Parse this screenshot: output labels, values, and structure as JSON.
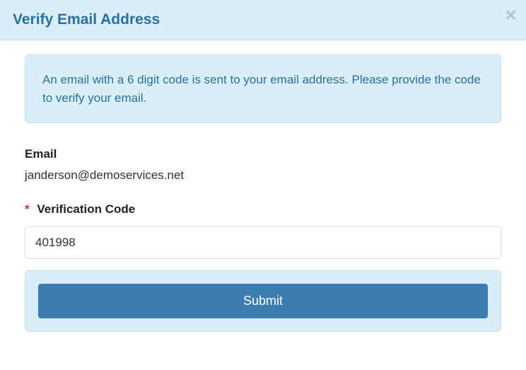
{
  "header": {
    "title": "Verify Email Address"
  },
  "info": {
    "message": "An email with a 6 digit code is sent to your email address. Please provide the code to verify your email."
  },
  "form": {
    "email_label": "Email",
    "email_value": "janderson@demoservices.net",
    "code_label": "Verification Code",
    "code_value": "401998",
    "required_mark": "*"
  },
  "actions": {
    "submit_label": "Submit"
  }
}
